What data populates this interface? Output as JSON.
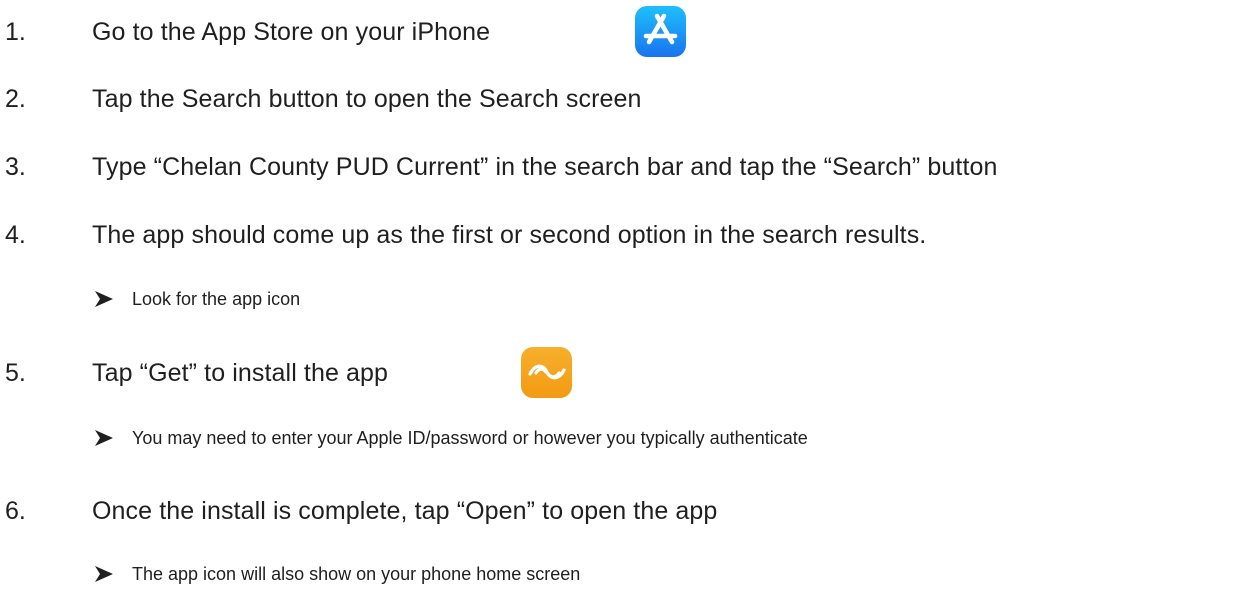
{
  "steps": [
    {
      "number": "1.",
      "text": "Go to the App Store on your iPhone"
    },
    {
      "number": "2.",
      "text": "Tap the Search button to open the Search screen"
    },
    {
      "number": "3.",
      "text": "Type “Chelan County PUD Current” in the search bar and tap the “Search” button"
    },
    {
      "number": "4.",
      "text": "The app should come up as the first or second option in the search results."
    },
    {
      "number": "5.",
      "text": "Tap “Get” to install the app"
    },
    {
      "number": "6.",
      "text": "Once the install is complete, tap “Open” to open the app"
    }
  ],
  "subpoints": [
    {
      "text": "Look for the app icon"
    },
    {
      "text": "You may need to enter your Apple ID/password or however you typically authenticate"
    },
    {
      "text": "The app icon will also show on your phone home screen"
    }
  ],
  "icons": {
    "app_store": "app-store-icon",
    "current_app": "chelan-current-app-icon",
    "bullet": "arrow-bullet-icon"
  },
  "colors": {
    "text": "#1f1f1f",
    "app_store_top": "#1ec0fc",
    "app_store_bottom": "#1a73ee",
    "current_app": "#f5a623"
  }
}
